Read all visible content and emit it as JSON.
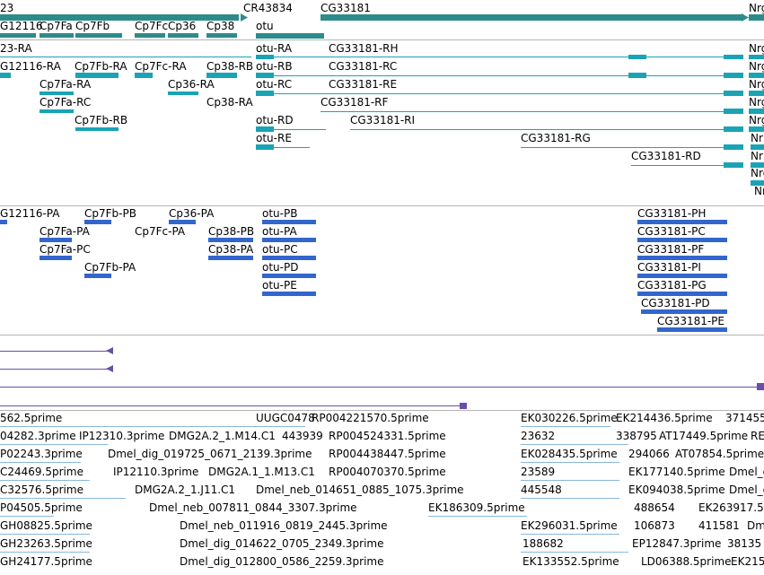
{
  "colors": {
    "gene": "#2e8b8b",
    "transcript": "#1aa3b5",
    "protein": "#3366cc",
    "aligned": "#6a4fa8",
    "est": "#88b8dd",
    "border": "#b4b4b4"
  },
  "gene_track": {
    "genes": [
      {
        "label": "23"
      },
      {
        "label": "CR43834"
      },
      {
        "label": "CG33181"
      },
      {
        "label": "Nrg"
      },
      {
        "label": "G12116"
      },
      {
        "label": "Cp7Fa"
      },
      {
        "label": "Cp7Fb"
      },
      {
        "label": "Cp7Fc"
      },
      {
        "label": "Cp36"
      },
      {
        "label": "Cp38"
      },
      {
        "label": "otu"
      }
    ]
  },
  "transcript_track": {
    "labels": [
      "23-RA",
      "otu-RA",
      "CG33181-RH",
      "Nrg",
      "G12116-RA",
      "Cp7Fb-RA",
      "Cp7Fc-RA",
      "Cp38-RB",
      "otu-RB",
      "CG33181-RC",
      "Nrg",
      "Cp7Fa-RA",
      "Cp36-RA",
      "otu-RC",
      "CG33181-RE",
      "Nrg",
      "Cp7Fa-RC",
      "Cp38-RA",
      "CG33181-RF",
      "Nrg",
      "Cp7Fb-RB",
      "otu-RD",
      "CG33181-RI",
      "Nrg",
      "otu-RE",
      "CG33181-RG",
      "Nr",
      "CG33181-RD",
      "Nr",
      "Nrg",
      "Nr"
    ]
  },
  "protein_track": {
    "labels": [
      "G12116-PA",
      "Cp7Fb-PB",
      "Cp36-PA",
      "otu-PB",
      "CG33181-PH",
      "Cp7Fa-PA",
      "Cp7Fc-PA",
      "Cp38-PB",
      "otu-PA",
      "CG33181-PC",
      "Cp7Fa-PC",
      "Cp38-PA",
      "otu-PC",
      "CG33181-PF",
      "Cp7Fb-PA",
      "otu-PD",
      "CG33181-PI",
      "otu-PE",
      "CG33181-PG",
      "CG33181-PD",
      "CG33181-PE"
    ]
  },
  "est_track": {
    "labels": [
      "562.5prime",
      "UUGC0478",
      "RP004221570.5prime",
      "EK030226.5prime",
      "EK214436.5prime",
      "371455",
      "04282.3prime",
      "IP12310.3prime",
      "DMG2A.2_1.M14.C1",
      "443939",
      "RP004524331.5prime",
      "23632",
      "338795",
      "AT17449.5prime",
      "RE",
      "P02243.3prime",
      "Dmel_dig_019725_0671_2139.3prime",
      "RP004438447.5prime",
      "EK028435.5prime",
      "294066",
      "AT07854.5prime",
      "C24469.5prime",
      "IP12110.3prime",
      "DMG2A.1_1.M13.C1",
      "RP004070370.5prime",
      "23589",
      "EK177140.5prime",
      "Dmel_c",
      "C32576.5prime",
      "DMG2A.2_1.J11.C1",
      "Dmel_neb_014651_0885_1075.3prime",
      "445548",
      "EK094038.5prime",
      "Dmel_c",
      "P04505.5prime",
      "Dmel_neb_007811_0844_3307.3prime",
      "EK186309.5prime",
      "488654",
      "EK263917.5",
      "GH08825.5prime",
      "Dmel_neb_011916_0819_2445.3prime",
      "EK296031.5prime",
      "106873",
      "411581",
      "Dm",
      "GH23263.5prime",
      "Dmel_dig_014622_0705_2349.3prime",
      "188682",
      "EP12847.3prime",
      "38135",
      "GH24177.5prime",
      "Dmel_dig_012800_0586_2259.3prime",
      "EK133552.5prime",
      "LD06388.5prime",
      "EK215"
    ]
  }
}
